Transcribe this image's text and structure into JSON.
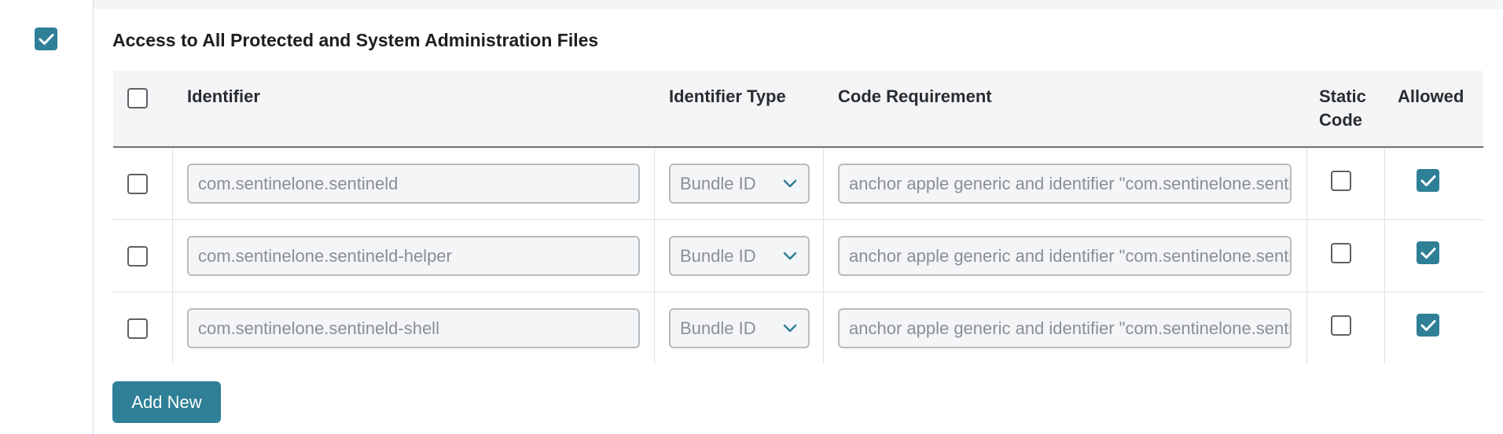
{
  "section": {
    "title": "Access to All Protected and System Administration Files",
    "enabled": true
  },
  "table": {
    "headers": {
      "identifier": "Identifier",
      "identifier_type": "Identifier Type",
      "code_requirement": "Code Requirement",
      "static_code_line1": "Static",
      "static_code_line2": "Code",
      "allowed": "Allowed"
    },
    "rows": [
      {
        "selected": false,
        "identifier": "com.sentinelone.sentineld",
        "identifier_type": "Bundle ID",
        "code_requirement": "anchor apple generic and identifier \"com.sentinelone.sentineld\"",
        "static_code": false,
        "allowed": true
      },
      {
        "selected": false,
        "identifier": "com.sentinelone.sentineld-helper",
        "identifier_type": "Bundle ID",
        "code_requirement": "anchor apple generic and identifier \"com.sentinelone.sentineld-helper\"",
        "static_code": false,
        "allowed": true
      },
      {
        "selected": false,
        "identifier": "com.sentinelone.sentineld-shell",
        "identifier_type": "Bundle ID",
        "code_requirement": "anchor apple generic and identifier \"com.sentinelone.sentineld-shell\"",
        "static_code": false,
        "allowed": true
      }
    ]
  },
  "actions": {
    "add_new_label": "Add New"
  },
  "icons": {
    "checkmark": "checkmark-icon",
    "dropdown": "chevron-down-icon"
  },
  "colors": {
    "accent": "#2f7f97",
    "header_bg": "#f4f5f7",
    "field_bg": "#f4f5f7",
    "border": "#b7bbbf"
  }
}
